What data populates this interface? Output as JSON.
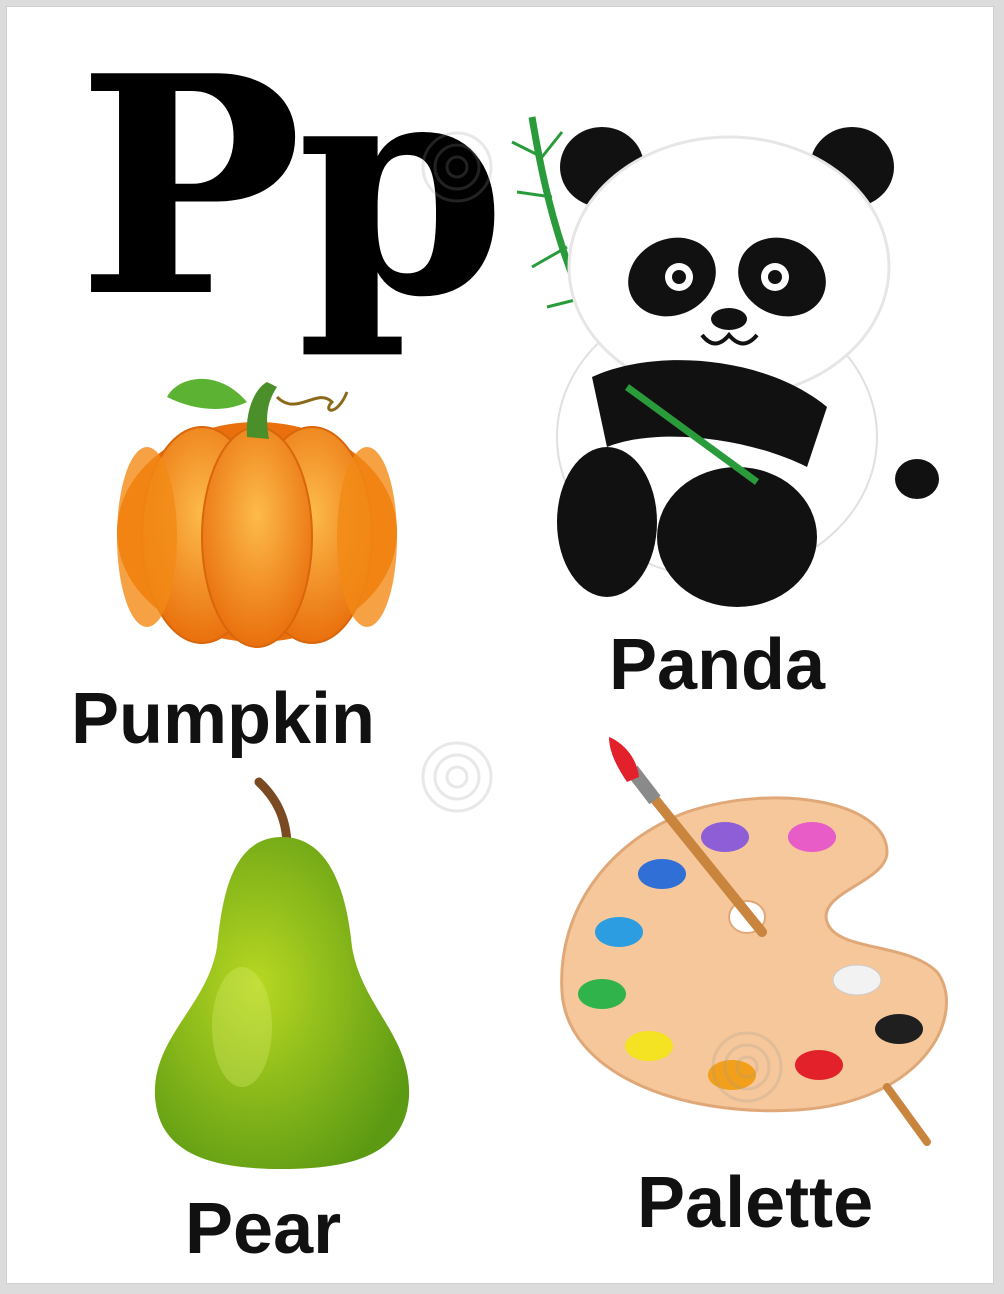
{
  "letter": "Pp",
  "words": {
    "pumpkin": "Pumpkin",
    "panda": "Panda",
    "pear": "Pear",
    "palette": "Palette"
  },
  "colors": {
    "pumpkin": "#f7961d",
    "pear": "#8cc21f",
    "palette": "#f5c79a",
    "paint": [
      "#8e5ed6",
      "#e85cc8",
      "#2f6fd6",
      "#2b9de0",
      "#2fb34a",
      "#f3e322",
      "#f2a01c",
      "#e3212a",
      "#1f1f1f",
      "#f2f2f2"
    ]
  },
  "icons": [
    "pumpkin-icon",
    "panda-icon",
    "pear-icon",
    "palette-icon"
  ]
}
